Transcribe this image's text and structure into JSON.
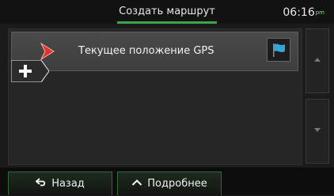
{
  "header": {
    "title": "Создать маршрут",
    "time": "06:16",
    "time_suffix": "pm"
  },
  "route": {
    "items": [
      {
        "label": "Текущее положение GPS"
      }
    ]
  },
  "footer": {
    "back_label": "Назад",
    "more_label": "Подробнее"
  },
  "colors": {
    "accent": "#3aa64a",
    "gps_icon": "#e0332b",
    "flag_icon": "#2fa7d8"
  }
}
